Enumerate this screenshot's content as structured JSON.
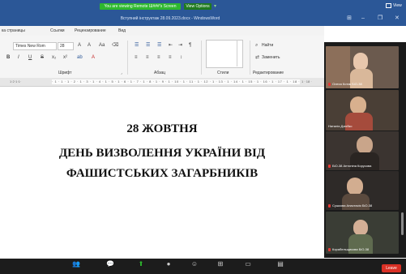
{
  "zoom": {
    "sharing_banner": "You are viewing Remote Ш###'s Screen",
    "view_options": "View Options",
    "view_button": "View",
    "toolbar_icons": [
      "participants-icon",
      "chat-icon",
      "share-screen-icon",
      "record-icon",
      "reactions-icon",
      "apps-icon",
      "whiteboard-icon",
      "notes-icon"
    ],
    "leave": "Leave",
    "accent_colors": {
      "banner": "#2eb82e",
      "leave": "#d93025",
      "share": "#2eb82e"
    }
  },
  "word": {
    "window_title": "Вступний інструктаж  28.09.2023.docx - WindowsWord",
    "window_buttons": [
      "⊞",
      "–",
      "❐",
      "✕"
    ],
    "menu_tabs": [
      "ка страницы",
      "Ссылки",
      "Рецензирование",
      "Вид"
    ],
    "font_name": "Times New Rom",
    "font_size": "28",
    "groups": {
      "font": "Шрифт",
      "paragraph": "Абзац",
      "styles": "Стили",
      "editing": "Редактирование"
    },
    "find": "Найти",
    "replace": "Заменить",
    "format_buttons": [
      "B",
      "I",
      "U",
      "S",
      "x₂",
      "x²",
      "ab",
      "A"
    ],
    "ruler_left": "1·2·1·1·",
    "ruler_digits": "· 1 · 1 · 1 · 2 · 1 · 3 · 1 · 4 · 1 · 5 · 1 · 6 · 1 · 7 · 1 · 8 · 1 · 9 · 1 · 10 · 1 · 11 · 1 · 12 · 1 · 13 · 1 · 14 · 1 · 15 · 1 · 16 · 1 · 17 · 1 · 18 ·",
    "ruler_right": "1 · 18 ·",
    "doc_lines": [
      "28 ЖОВТНЯ",
      "ДЕНЬ ВИЗВОЛЕННЯ УКРАЇНИ ВІД",
      "ФАШИСТСЬКИХ ЗАГАРБНИКІВ"
    ]
  },
  "participants": [
    {
      "name": "Олеся Котик БіО-38",
      "bg": "#6b5a4e",
      "accent": "#a0826d"
    },
    {
      "name": "Наталія Дзюбко",
      "bg": "#4a3f36",
      "accent": "#c9a890"
    },
    {
      "name": "БіО-38 Антоніна Корусова",
      "bg": "#3b3430",
      "accent": "#7e6a5c"
    },
    {
      "name": "Сушкова Анастасія БіО-38",
      "bg": "#2e2a28",
      "accent": "#8a6e5a"
    },
    {
      "name": "Корабельщикова БіО-38",
      "bg": "#3a3d35",
      "accent": "#6e7c5a"
    }
  ]
}
